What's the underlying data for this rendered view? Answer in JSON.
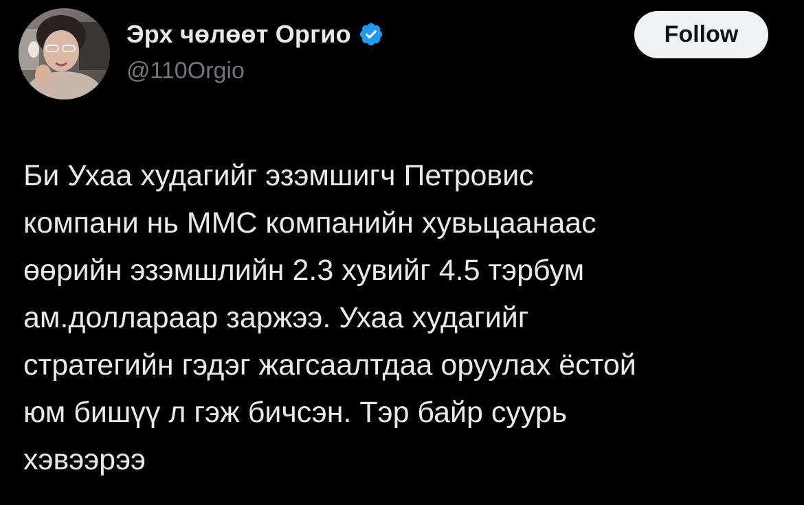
{
  "author": {
    "display_name": "Эрх чөлөөт Оргио",
    "handle": "@110Orgio",
    "verified_icon": "verified-badge-icon",
    "avatar_icon": "profile-avatar"
  },
  "actions": {
    "follow_label": "Follow"
  },
  "tweet": {
    "lines": [
      "Би Ухаа худагийг эзэмшигч Петровис",
      "компани нь ММС компанийн хувьцаанаас",
      "өөрийн эзэмшлийн 2.3 хувийг 4.5 тэрбум",
      "ам.доллараар заржээ. Ухаа худагийг",
      "стратегийн гэдэг жагсаалтдаа оруулах ёстой",
      "юм бишүү л гэж бичсэн. Тэр байр суурь",
      "хэвээрээ"
    ]
  },
  "colors": {
    "background": "#000000",
    "text": "#e7e9ea",
    "secondary_text": "#71767b",
    "verified_blue": "#1d9bf0",
    "follow_bg": "#eff3f4"
  }
}
